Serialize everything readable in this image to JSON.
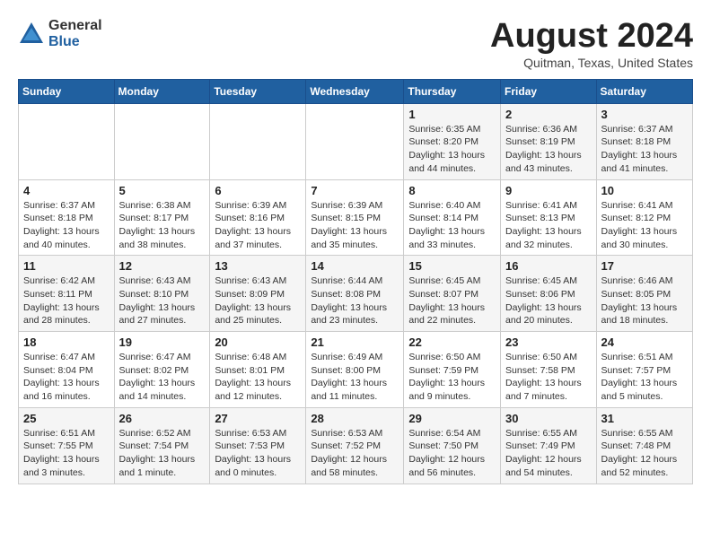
{
  "logo": {
    "general": "General",
    "blue": "Blue"
  },
  "title": "August 2024",
  "location": "Quitman, Texas, United States",
  "days_of_week": [
    "Sunday",
    "Monday",
    "Tuesday",
    "Wednesday",
    "Thursday",
    "Friday",
    "Saturday"
  ],
  "weeks": [
    [
      {
        "day": "",
        "detail": ""
      },
      {
        "day": "",
        "detail": ""
      },
      {
        "day": "",
        "detail": ""
      },
      {
        "day": "",
        "detail": ""
      },
      {
        "day": "1",
        "detail": "Sunrise: 6:35 AM\nSunset: 8:20 PM\nDaylight: 13 hours\nand 44 minutes."
      },
      {
        "day": "2",
        "detail": "Sunrise: 6:36 AM\nSunset: 8:19 PM\nDaylight: 13 hours\nand 43 minutes."
      },
      {
        "day": "3",
        "detail": "Sunrise: 6:37 AM\nSunset: 8:18 PM\nDaylight: 13 hours\nand 41 minutes."
      }
    ],
    [
      {
        "day": "4",
        "detail": "Sunrise: 6:37 AM\nSunset: 8:18 PM\nDaylight: 13 hours\nand 40 minutes."
      },
      {
        "day": "5",
        "detail": "Sunrise: 6:38 AM\nSunset: 8:17 PM\nDaylight: 13 hours\nand 38 minutes."
      },
      {
        "day": "6",
        "detail": "Sunrise: 6:39 AM\nSunset: 8:16 PM\nDaylight: 13 hours\nand 37 minutes."
      },
      {
        "day": "7",
        "detail": "Sunrise: 6:39 AM\nSunset: 8:15 PM\nDaylight: 13 hours\nand 35 minutes."
      },
      {
        "day": "8",
        "detail": "Sunrise: 6:40 AM\nSunset: 8:14 PM\nDaylight: 13 hours\nand 33 minutes."
      },
      {
        "day": "9",
        "detail": "Sunrise: 6:41 AM\nSunset: 8:13 PM\nDaylight: 13 hours\nand 32 minutes."
      },
      {
        "day": "10",
        "detail": "Sunrise: 6:41 AM\nSunset: 8:12 PM\nDaylight: 13 hours\nand 30 minutes."
      }
    ],
    [
      {
        "day": "11",
        "detail": "Sunrise: 6:42 AM\nSunset: 8:11 PM\nDaylight: 13 hours\nand 28 minutes."
      },
      {
        "day": "12",
        "detail": "Sunrise: 6:43 AM\nSunset: 8:10 PM\nDaylight: 13 hours\nand 27 minutes."
      },
      {
        "day": "13",
        "detail": "Sunrise: 6:43 AM\nSunset: 8:09 PM\nDaylight: 13 hours\nand 25 minutes."
      },
      {
        "day": "14",
        "detail": "Sunrise: 6:44 AM\nSunset: 8:08 PM\nDaylight: 13 hours\nand 23 minutes."
      },
      {
        "day": "15",
        "detail": "Sunrise: 6:45 AM\nSunset: 8:07 PM\nDaylight: 13 hours\nand 22 minutes."
      },
      {
        "day": "16",
        "detail": "Sunrise: 6:45 AM\nSunset: 8:06 PM\nDaylight: 13 hours\nand 20 minutes."
      },
      {
        "day": "17",
        "detail": "Sunrise: 6:46 AM\nSunset: 8:05 PM\nDaylight: 13 hours\nand 18 minutes."
      }
    ],
    [
      {
        "day": "18",
        "detail": "Sunrise: 6:47 AM\nSunset: 8:04 PM\nDaylight: 13 hours\nand 16 minutes."
      },
      {
        "day": "19",
        "detail": "Sunrise: 6:47 AM\nSunset: 8:02 PM\nDaylight: 13 hours\nand 14 minutes."
      },
      {
        "day": "20",
        "detail": "Sunrise: 6:48 AM\nSunset: 8:01 PM\nDaylight: 13 hours\nand 12 minutes."
      },
      {
        "day": "21",
        "detail": "Sunrise: 6:49 AM\nSunset: 8:00 PM\nDaylight: 13 hours\nand 11 minutes."
      },
      {
        "day": "22",
        "detail": "Sunrise: 6:50 AM\nSunset: 7:59 PM\nDaylight: 13 hours\nand 9 minutes."
      },
      {
        "day": "23",
        "detail": "Sunrise: 6:50 AM\nSunset: 7:58 PM\nDaylight: 13 hours\nand 7 minutes."
      },
      {
        "day": "24",
        "detail": "Sunrise: 6:51 AM\nSunset: 7:57 PM\nDaylight: 13 hours\nand 5 minutes."
      }
    ],
    [
      {
        "day": "25",
        "detail": "Sunrise: 6:51 AM\nSunset: 7:55 PM\nDaylight: 13 hours\nand 3 minutes."
      },
      {
        "day": "26",
        "detail": "Sunrise: 6:52 AM\nSunset: 7:54 PM\nDaylight: 13 hours\nand 1 minute."
      },
      {
        "day": "27",
        "detail": "Sunrise: 6:53 AM\nSunset: 7:53 PM\nDaylight: 13 hours\nand 0 minutes."
      },
      {
        "day": "28",
        "detail": "Sunrise: 6:53 AM\nSunset: 7:52 PM\nDaylight: 12 hours\nand 58 minutes."
      },
      {
        "day": "29",
        "detail": "Sunrise: 6:54 AM\nSunset: 7:50 PM\nDaylight: 12 hours\nand 56 minutes."
      },
      {
        "day": "30",
        "detail": "Sunrise: 6:55 AM\nSunset: 7:49 PM\nDaylight: 12 hours\nand 54 minutes."
      },
      {
        "day": "31",
        "detail": "Sunrise: 6:55 AM\nSunset: 7:48 PM\nDaylight: 12 hours\nand 52 minutes."
      }
    ]
  ]
}
